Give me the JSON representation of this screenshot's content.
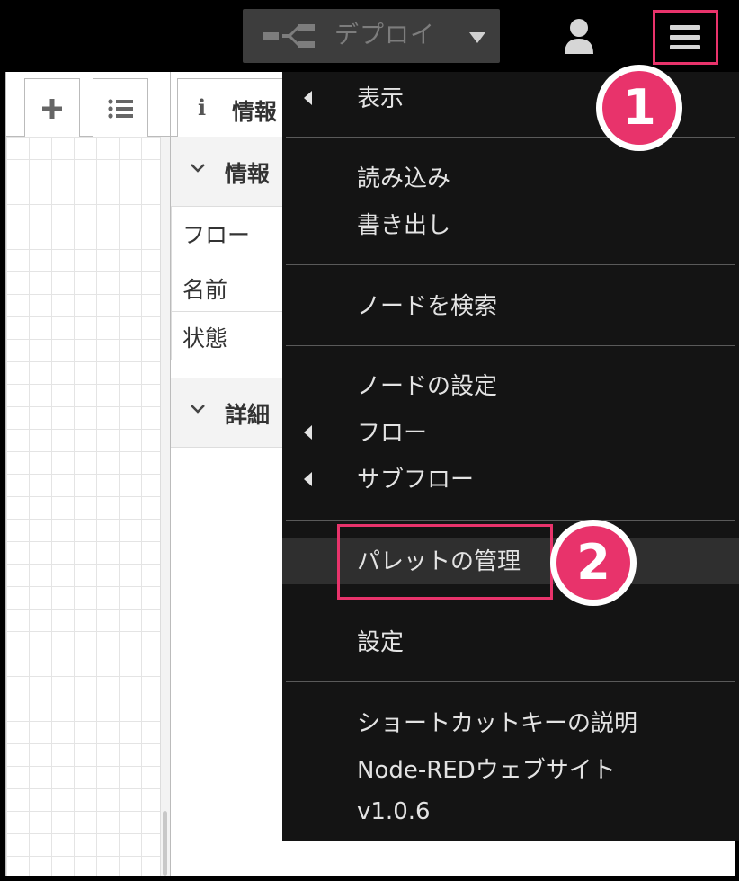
{
  "header": {
    "deploy_label": "デプロイ"
  },
  "sidebar": {
    "tab_info_icon": "i",
    "tab_info_label": "情報",
    "section_info_label": "情報",
    "rows": [
      "フロー",
      "名前",
      "状態"
    ],
    "section_detail_label": "詳細"
  },
  "menu": {
    "items": [
      {
        "label": "表示",
        "submenu": true
      },
      {
        "label": "読み込み",
        "submenu": false
      },
      {
        "label": "書き出し",
        "submenu": false
      },
      {
        "label": "ノードを検索",
        "submenu": false
      },
      {
        "label": "ノードの設定",
        "submenu": false
      },
      {
        "label": "フロー",
        "submenu": true
      },
      {
        "label": "サブフロー",
        "submenu": true
      },
      {
        "label": "パレットの管理",
        "submenu": false,
        "highlighted": true
      },
      {
        "label": "設定",
        "submenu": false
      },
      {
        "label": "ショートカットキーの説明",
        "submenu": false
      },
      {
        "label": "Node-REDウェブサイト",
        "submenu": false
      },
      {
        "label": "v1.0.6",
        "submenu": false
      }
    ]
  },
  "annotations": {
    "badge_1": "1",
    "badge_2": "2",
    "color": "#e8336b"
  },
  "icons": {
    "deploy": "deploy-icon",
    "caret": "caret-down-icon",
    "user": "user-icon",
    "menu": "hamburger-menu-icon",
    "add": "plus-icon",
    "list": "list-icon",
    "info": "info-icon",
    "chevron": "chevron-down-icon",
    "submenu_arrow": "caret-left-icon"
  },
  "colors": {
    "header_bg": "#000000",
    "deploy_bg": "#3d3d3d",
    "menu_bg": "#141414",
    "menu_hover_bg": "#2f2f2f",
    "menu_text": "#e3e3e3",
    "accent": "#e8336b"
  }
}
